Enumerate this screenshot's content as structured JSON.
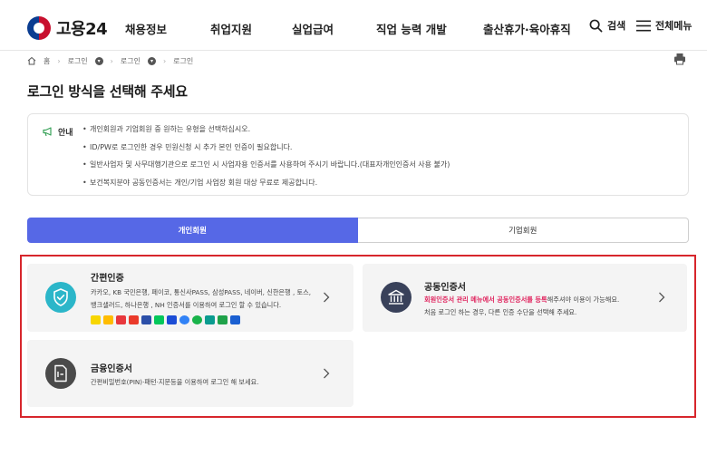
{
  "header": {
    "logo_text": "고용24",
    "nav": [
      "채용정보",
      "취업지원",
      "실업급여",
      "직업 능력 개발",
      "출산휴가·육아휴직"
    ],
    "search_label": "검색",
    "menu_label": "전체메뉴"
  },
  "breadcrumb": {
    "home": "홈",
    "items": [
      "로그인",
      "로그인",
      "로그인"
    ]
  },
  "page_title": "로그인 방식을 선택해 주세요",
  "notice": {
    "label": "안내",
    "items": [
      "개인회원과 기업회원 중 원하는 유형을 선택하십시오.",
      "ID/PW로 로그인한 경우 민원신청 시 추가 본인 인증이 필요합니다.",
      "일반사업자 및 사무대행기관으로 로그인 시 사업자용 인증서를 사용하여 주시기 바랍니다.(대표자개인인증서 사용 불가)",
      "보건복지분야 공동인증서는 개인/기업 사업장 회원 대상 무료로 제공합니다."
    ]
  },
  "tabs": {
    "personal": "개인회원",
    "business": "기업회원"
  },
  "cards": {
    "simple": {
      "title": "간편인증",
      "desc_line1": "카카오, KB 국민은행, 페이코, 통신사PASS, 삼성PASS, 네이버, 신한은행 , 토스,",
      "desc_line2": "뱅크샐러드, 하나은행 , NH 인증서를 이용하여 로그인 할 수 있습니다."
    },
    "joint": {
      "title": "공동인증서",
      "desc_highlight": "회원인증서 관리 메뉴에서 공동인증서를 등록",
      "desc_rest": "해주셔야 이용이 가능해요.",
      "desc_line2": "처음 로그인 하는 경우, 다른 인증 수단을 선택해 주세요."
    },
    "financial": {
      "title": "금융인증서",
      "desc": "간편비밀번호(PIN)·패턴·지문등을 이용하여 로그인 해 보세요."
    }
  },
  "colors": {
    "accent": "#5668e6",
    "highlight_border": "#d7262c",
    "simple_icon": "#2bb6c9",
    "joint_icon": "#39415a",
    "financial_icon": "#4a4a4a",
    "link_pink": "#e0245e"
  }
}
